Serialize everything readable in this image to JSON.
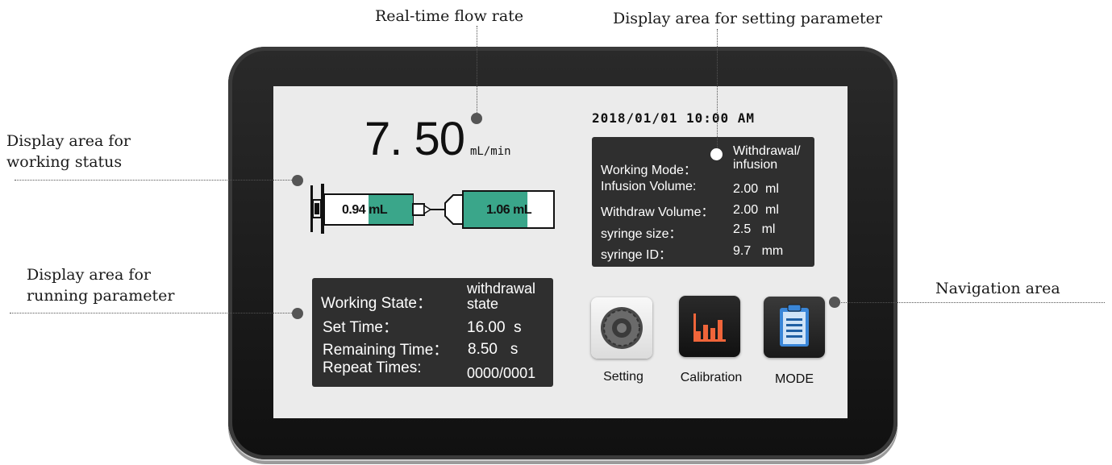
{
  "callouts": {
    "flow_rate": "Real-time flow rate",
    "setting_parameter": "Display area for setting parameter",
    "working_status": [
      "Display area for",
      "working status"
    ],
    "running_parameter": [
      "Display area for",
      "running parameter"
    ],
    "navigation": "Navigation area"
  },
  "screen": {
    "flow_value": "7. 50",
    "flow_unit": "mL/min",
    "datetime": "2018/01/01 10:00 AM",
    "syringes": {
      "left_volume": "0.94 mL",
      "left_fill_fraction": 0.5,
      "right_volume": "1.06 mL",
      "right_fill_fraction": 0.7,
      "fill_color": "#3aa68a"
    },
    "settings_panel": {
      "rows": [
        {
          "label": "Working Mode：",
          "value": "Withdrawal/ infusion"
        },
        {
          "label": "Infusion Volume:",
          "value": "2.00  ml"
        },
        {
          "label": "Withdraw Volume：",
          "value": "2.00  ml"
        },
        {
          "label": "syringe size：",
          "value": "2.5   ml"
        },
        {
          "label": "syringe ID：",
          "value": "9.7   mm"
        }
      ]
    },
    "running_panel": {
      "rows": [
        {
          "label": "Working State：",
          "value": "withdrawal state"
        },
        {
          "label": "Set Time：",
          "value": "16.00  s"
        },
        {
          "label": "Remaining Time：",
          "value": "8.50   s"
        },
        {
          "label": "Repeat Times:",
          "value": "0000/0001"
        }
      ]
    },
    "navigation": [
      {
        "label": "Setting",
        "icon": "gear-icon"
      },
      {
        "label": "Calibration",
        "icon": "bar-chart-icon"
      },
      {
        "label": "MODE",
        "icon": "clipboard-icon"
      }
    ]
  },
  "colors": {
    "bezel": "#1b1b1b",
    "screen": "#ebebeb",
    "panel": "#2f2f2f",
    "accent_orange": "#f0653a",
    "accent_blue": "#3a86d8"
  }
}
